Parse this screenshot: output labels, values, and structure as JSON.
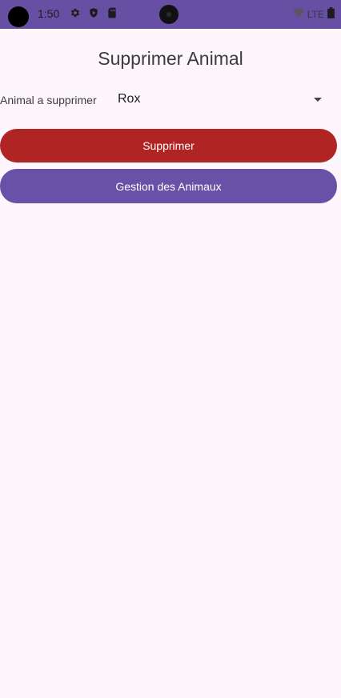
{
  "status_bar": {
    "time": "1:50",
    "network": "LTE",
    "icons": [
      "settings-icon",
      "play-protect-icon",
      "sim-card-icon",
      "wifi-icon",
      "battery-icon"
    ],
    "colors": {
      "background": "#6750a4"
    }
  },
  "screen": {
    "title": "Supprimer Animal",
    "field_label": "Animal a supprimer",
    "selected_animal": "Rox",
    "delete_button": "Supprimer",
    "manage_button": "Gestion des Animaux"
  },
  "colors": {
    "page_background": "#fdf7fd",
    "delete_button": "#b02424",
    "manage_button": "#6a51a8"
  }
}
